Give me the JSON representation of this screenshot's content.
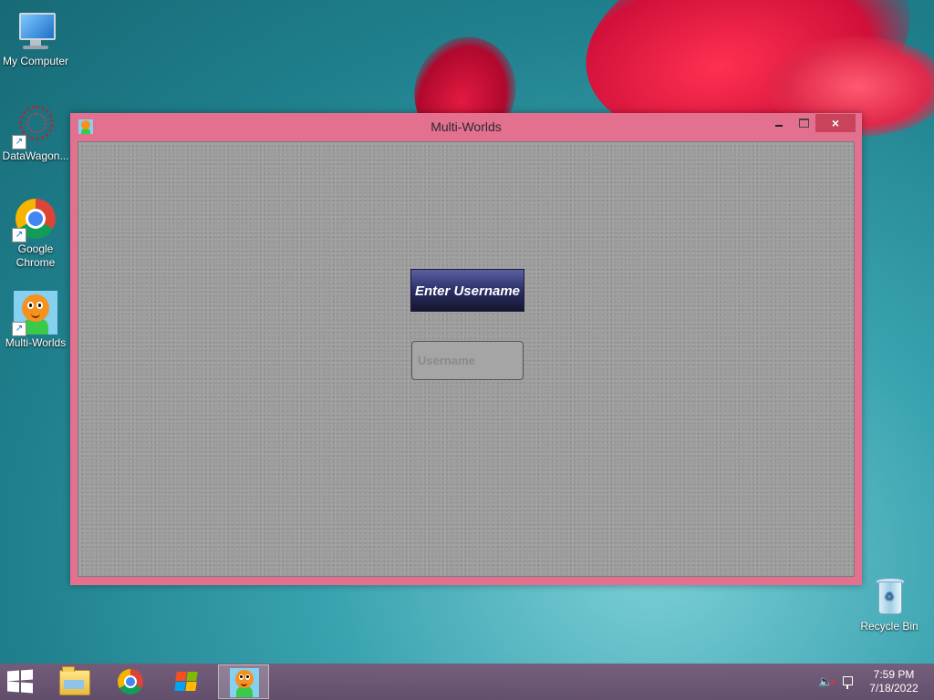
{
  "desktop": {
    "icons": [
      {
        "label": "My Computer",
        "icon": "computer-icon"
      },
      {
        "label": "DataWagon...",
        "icon": "datawagon-icon"
      },
      {
        "label": "Google Chrome",
        "icon": "chrome-icon"
      },
      {
        "label": "Multi-Worlds",
        "icon": "multi-worlds-icon"
      },
      {
        "label": "Recycle Bin",
        "icon": "recycle-bin-icon"
      }
    ]
  },
  "window": {
    "title": "Multi-Worlds",
    "controls": {
      "minimize": "minimize-icon",
      "maximize": "maximize-icon",
      "close": "×"
    },
    "content": {
      "prompt_label": "Enter Username",
      "username_input": {
        "value": "",
        "placeholder": "Username"
      }
    }
  },
  "taskbar": {
    "start": "windows-start-icon",
    "items": [
      {
        "name": "file-explorer",
        "icon": "folder-icon",
        "active": false
      },
      {
        "name": "google-chrome",
        "icon": "chrome-icon",
        "active": false
      },
      {
        "name": "windows-media-player",
        "icon": "media-player-icon",
        "active": false
      },
      {
        "name": "multi-worlds",
        "icon": "multi-worlds-icon",
        "active": true
      }
    ],
    "tray": {
      "volume": "volume-muted-icon",
      "network": "network-icon",
      "time": "7:59 PM",
      "date": "7/18/2022"
    }
  },
  "colors": {
    "window_frame": "#e3708f",
    "close_button": "#c9445a",
    "label_bg": "#2c2f66",
    "client_bg": "#9c9c9c"
  }
}
